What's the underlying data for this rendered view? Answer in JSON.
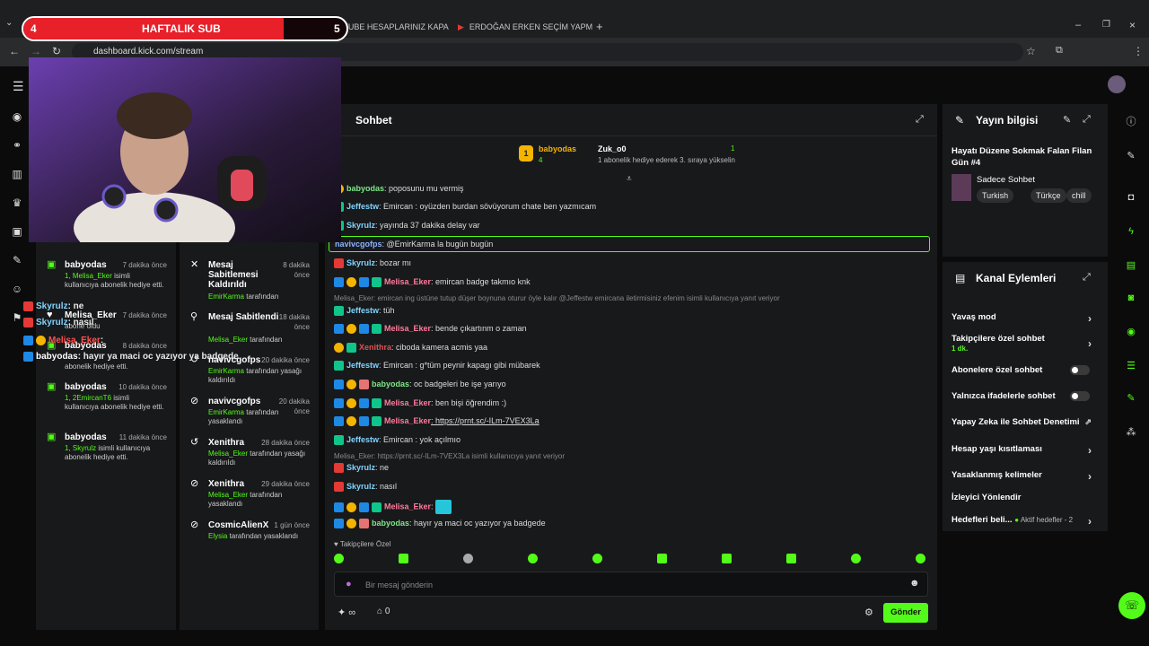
{
  "browser": {
    "tabs": [
      {
        "label": "YOUTUBE HESAPLARINIZ KAPA"
      },
      {
        "label": "ERDOĞAN ERKEN SEÇİM YAPM"
      }
    ],
    "url": "dashboard.kick.com/stream"
  },
  "overlay": {
    "sub_count": "4",
    "sub_label": "HAFTALIK SUB",
    "sub_number": "5"
  },
  "panel_events": [
    {
      "name": "babyodas",
      "time": "7 dakika önce",
      "desc_user": "1, Melisa_Eker",
      "desc": "isimli kullanıcıya abonelik hediye etti."
    },
    {
      "name": "Melisa_Eker",
      "time": "7 dakika önce",
      "desc_user": "",
      "desc": "abone oldu"
    },
    {
      "name": "babyodas",
      "time": "8 dakika önce",
      "desc_user": "",
      "desc": "abonelik hediye etti."
    },
    {
      "name": "babyodas",
      "time": "10 dakika önce",
      "desc_user": "1, 2EmircanT6",
      "desc": "isimli kullanıcıya abonelik hediye etti."
    },
    {
      "name": "babyodas",
      "time": "11 dakika önce",
      "desc_user": "1, Skyrulz",
      "desc": "isimli kullanıcıya abonelik hediye etti."
    }
  ],
  "panel_mod": [
    {
      "title": "Mesaj Sabitlemesi Kaldırıldı",
      "time": "8 dakika önce",
      "by": "EmirKarma",
      "suffix": "tarafından"
    },
    {
      "title": "Mesaj Sabitlendi",
      "time": "18 dakika önce",
      "by": "Melisa_Eker",
      "suffix": "tarafından"
    },
    {
      "title": "navivcgofps",
      "time": "20 dakika önce",
      "by": "EmirKarma",
      "suffix": "tarafından yasağı kaldırıldı"
    },
    {
      "title": "navivcgofps",
      "time": "20 dakika önce",
      "by": "EmirKarma",
      "suffix": "tarafından yasaklandı"
    },
    {
      "title": "Xenithra",
      "time": "28 dakika önce",
      "by": "Melisa_Eker",
      "suffix": "tarafından yasağı kaldırıldı"
    },
    {
      "title": "Xenithra",
      "time": "29 dakika önce",
      "by": "Melisa_Eker",
      "suffix": "tarafından yasaklandı"
    },
    {
      "title": "CosmicAlienX",
      "time": "1 gün önce",
      "by": "Elysia",
      "suffix": "tarafından yasaklandı"
    }
  ],
  "overlay_chat": [
    {
      "user": "Skyrulz",
      "text": ": ne"
    },
    {
      "user": "Skyrulz",
      "text": ": nasıl"
    },
    {
      "user": "Melisa_Eker",
      "text": ":"
    },
    {
      "user": "babyodas",
      "text": ": hayır ya maci oc yazıyor ya badgede"
    }
  ],
  "chat": {
    "title": "Sohbet",
    "top_gifter_1": "babyodas",
    "top_gifter_1_count": "4",
    "top_gifter_2": "Zuk_o0",
    "top_gifter_2_count": "1",
    "gift_hint": "1 abonelik hediye ederek 3. sıraya yükselin",
    "messages": [
      {
        "user": "babyodas",
        "text": ": poposunu mu vermiş",
        "color": "#7ee787"
      },
      {
        "user": "Jeffestw",
        "text": ": Emircan : oyüzden burdan sövüyorum chate ben yazmıcam",
        "color": "#7fd3ff"
      },
      {
        "user": "Skyrulz",
        "text": ": yayında 37 dakika delay var",
        "color": "#7fd3ff"
      },
      {
        "user": "navivcgofps",
        "text": ": @EmirKarma la bugün bugün",
        "color": "#8ab4ff"
      },
      {
        "user": "Skyrulz",
        "text": ": bozar mı",
        "color": "#7fd3ff"
      },
      {
        "user": "Melisa_Eker",
        "text": ": emircan badge takmıo knk",
        "color": "#ff7b9c"
      },
      {
        "user": "Jeffestw",
        "text": ": tüh",
        "color": "#7fd3ff"
      },
      {
        "user": "Melisa_Eker",
        "text": ": bende çıkartınm o zaman",
        "color": "#ff7b9c"
      },
      {
        "user": "Xenithra",
        "text": ": ciboda kamera acmis yaa",
        "color": "#e05050"
      },
      {
        "user": "Jeffestw",
        "text": ": Emircan : g*tüm peynir kapagı gibi mübarek",
        "color": "#7fd3ff"
      },
      {
        "user": "babyodas",
        "text": ": oc badgeleri be işe yarıyo",
        "color": "#7ee787"
      },
      {
        "user": "Melisa_Eker",
        "text": ": ben bişi öğrendim :)",
        "color": "#ff7b9c"
      },
      {
        "user": "Melisa_Eker",
        "text": ": https://prnt.sc/-ILm-7VEX3La",
        "color": "#ff7b9c"
      },
      {
        "user": "Jeffestw",
        "text": ": Emircan : yok açılmıo",
        "color": "#7fd3ff"
      },
      {
        "user": "Skyrulz",
        "text": ": ne",
        "color": "#7fd3ff"
      },
      {
        "user": "Skyrulz",
        "text": ": nasıl",
        "color": "#7fd3ff"
      },
      {
        "user": "Melisa_Eker",
        "text": ":",
        "color": "#ff7b9c"
      },
      {
        "user": "babyodas",
        "text": ": hayır ya maci oc yazıyor ya badgede",
        "color": "#7ee787"
      }
    ],
    "reply_1": "Melisa_Eker: emircan ing üstüne tutup düşer boynuna oturur öyle kalır @Jeffestw emircana iletirmisiniz efenim isimli kullanıcıya yanıt veriyor",
    "reply_2": "Melisa_Eker: https://prnt.sc/-ILm-7VEX3La isimli kullanıcıya yanıt veriyor",
    "followers_only": "Takipçilere Özel",
    "input_placeholder": "Bir mesaj gönderin",
    "points": "∞",
    "store_count": "0",
    "send_label": "Gönder"
  },
  "stream_info": {
    "title": "Yayın bilgisi",
    "stream_title": "Hayatı Düzene Sokmak Falan Filan Gün #4",
    "category": "Sadece Sohbet",
    "tags": [
      "Turkish",
      "Türkçe",
      "chill"
    ]
  },
  "channel_actions": {
    "title": "Kanal Eylemleri",
    "items": [
      {
        "label": "Yavaş mod",
        "type": "chevron"
      },
      {
        "label": "Takipçilere özel sohbet",
        "sub": "1 dk.",
        "type": "chevron"
      },
      {
        "label": "Abonelere özel sohbet",
        "type": "toggle"
      },
      {
        "label": "Yalnızca ifadelerle sohbet",
        "type": "toggle"
      },
      {
        "label": "Yapay Zeka ile Sohbet Denetimi",
        "type": "external"
      },
      {
        "label": "Hesap yaşı kısıtlaması",
        "type": "chevron"
      },
      {
        "label": "Yasaklanmış kelimeler",
        "type": "chevron"
      },
      {
        "label": "İzleyici Yönlendir",
        "type": "none"
      },
      {
        "label": "Hedefleri beli...",
        "sub": "Aktif hedefler - 2",
        "type": "chevron"
      }
    ]
  },
  "colors": {
    "accent": "#53fc18",
    "panel": "#18191b",
    "bg": "#0b0b0c"
  }
}
